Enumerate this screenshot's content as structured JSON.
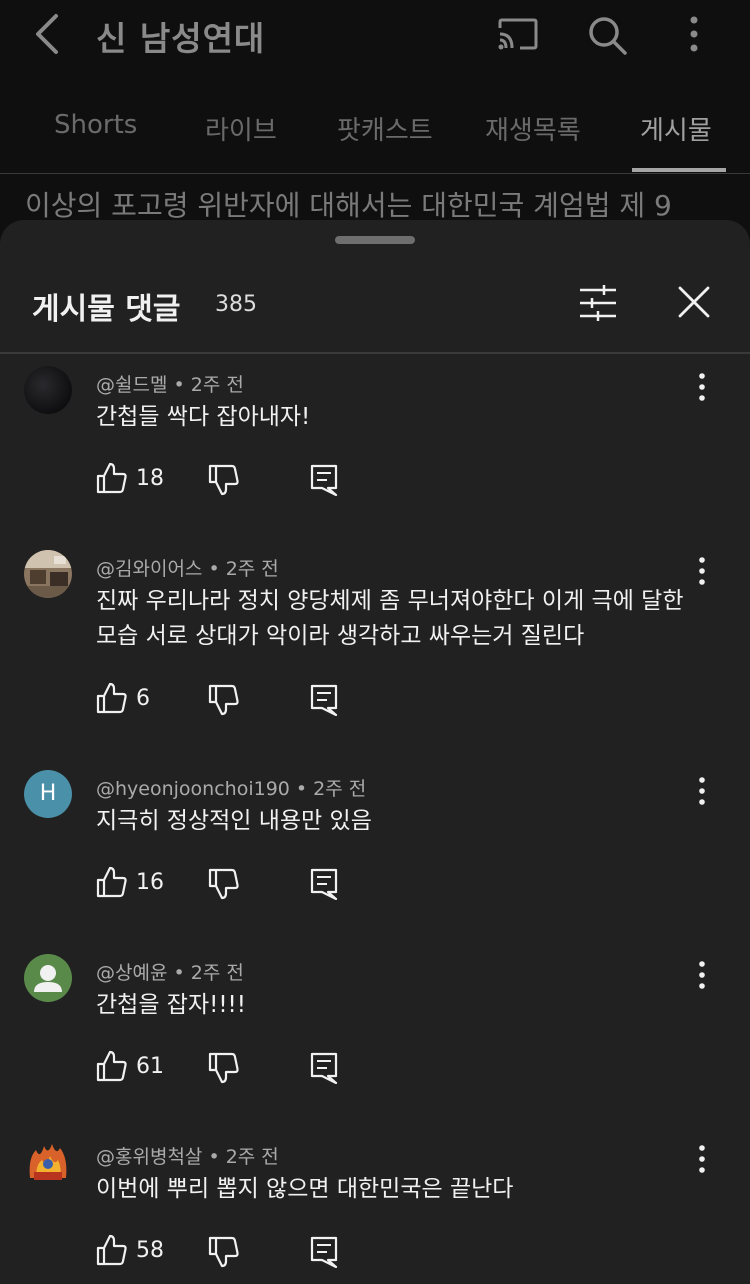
{
  "header": {
    "channel_title": "신 남성연대",
    "icons": [
      "back-icon",
      "cast-icon",
      "search-icon",
      "more-vert-icon"
    ]
  },
  "tabs": [
    {
      "label": "Shorts",
      "active": false
    },
    {
      "label": "라이브",
      "active": false
    },
    {
      "label": "팟캐스트",
      "active": false
    },
    {
      "label": "재생목록",
      "active": false
    },
    {
      "label": "게시물",
      "active": true
    }
  ],
  "post_peek": "이상의 포고령 위반자에 대해서는 대한민국 계엄법 제 9",
  "sheet": {
    "title": "게시물 댓글",
    "count": "385"
  },
  "comments": [
    {
      "author": "@쉴드멜",
      "time": "2주 전",
      "text": "간첩들 싹다 잡아내자!",
      "likes": "18",
      "avatar": "dark-avatar"
    },
    {
      "author": "@김와이어스",
      "time": "2주 전",
      "text": "진짜 우리나라 정치 양당체제 좀 무너져야한다 이게 극에 달한 모습 서로 상대가 악이라 생각하고 싸우는거 질린다",
      "likes": "6",
      "avatar": "photo-avatar"
    },
    {
      "author": "@hyeonjoonchoi190",
      "time": "2주 전",
      "text": "지극히 정상적인 내용만 있음",
      "likes": "16",
      "avatar": "letter-avatar",
      "avatar_letter": "H",
      "avatar_color": "#4a90a8"
    },
    {
      "author": "@상예윤",
      "time": "2주 전",
      "text": "간첩을 잡자!!!!",
      "likes": "61",
      "avatar": "default-person-avatar",
      "avatar_color": "#5a8a4a"
    },
    {
      "author": "@홍위병척살",
      "time": "2주 전",
      "text": "이번에 뿌리 뽑지 않으면 대한민국은 끝난다",
      "likes": "58",
      "avatar": "emblem-avatar"
    }
  ]
}
